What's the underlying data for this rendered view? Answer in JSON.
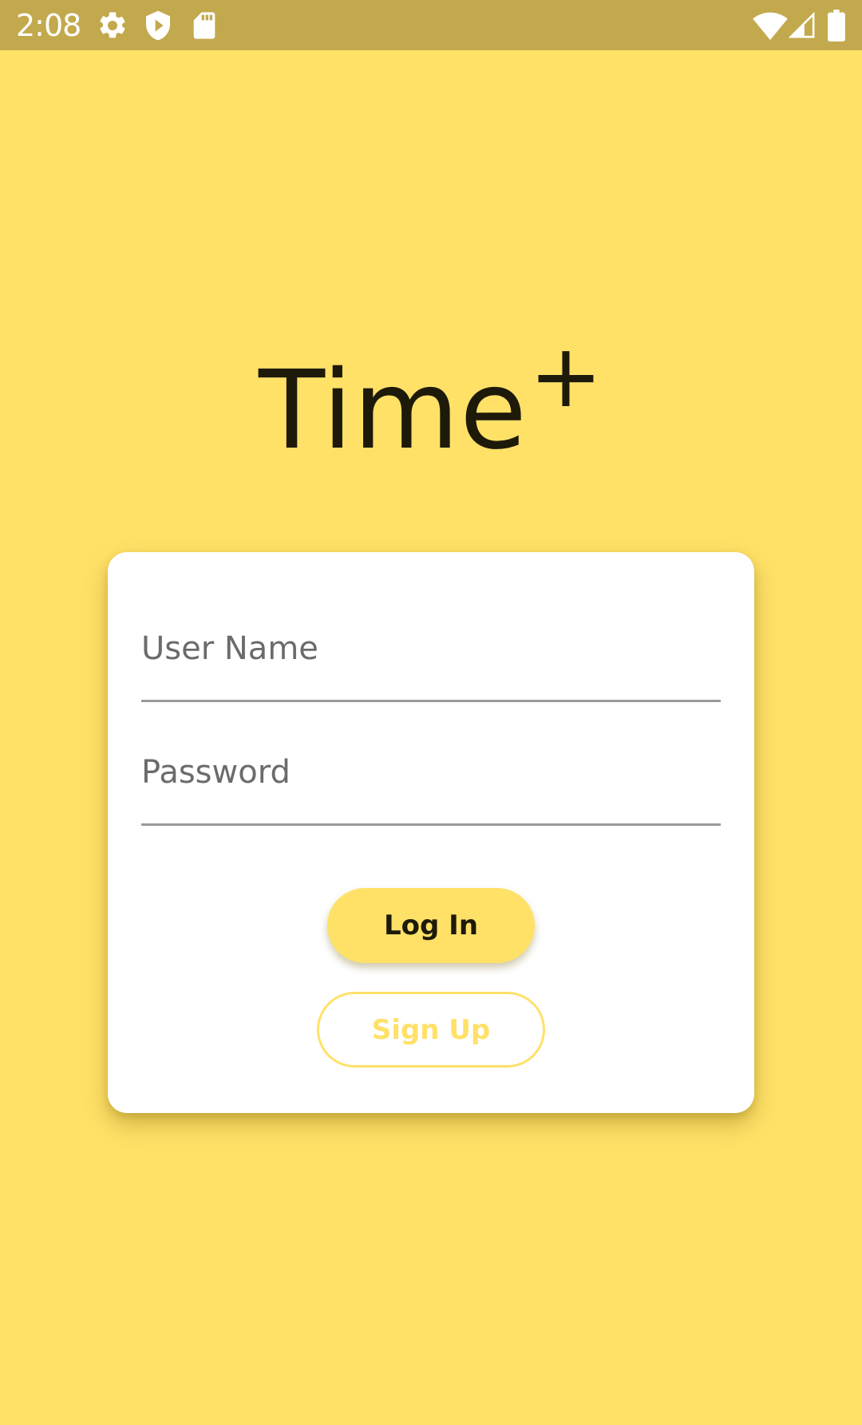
{
  "status_bar": {
    "time": "2:08",
    "icons": [
      "gear-icon",
      "shield-play-icon",
      "sd-card-icon",
      "wifi-icon",
      "signal-icon",
      "battery-icon"
    ]
  },
  "app": {
    "title": "Time",
    "title_superscript": "+"
  },
  "login_form": {
    "username_placeholder": "User Name",
    "password_placeholder": "Password",
    "login_label": "Log In",
    "signup_label": "Sign Up"
  },
  "colors": {
    "background": "#FFE168",
    "status_bar": "#C3A94D",
    "accent": "#FFE168",
    "text_dark": "#1E1A0A",
    "card": "#FFFFFF"
  }
}
